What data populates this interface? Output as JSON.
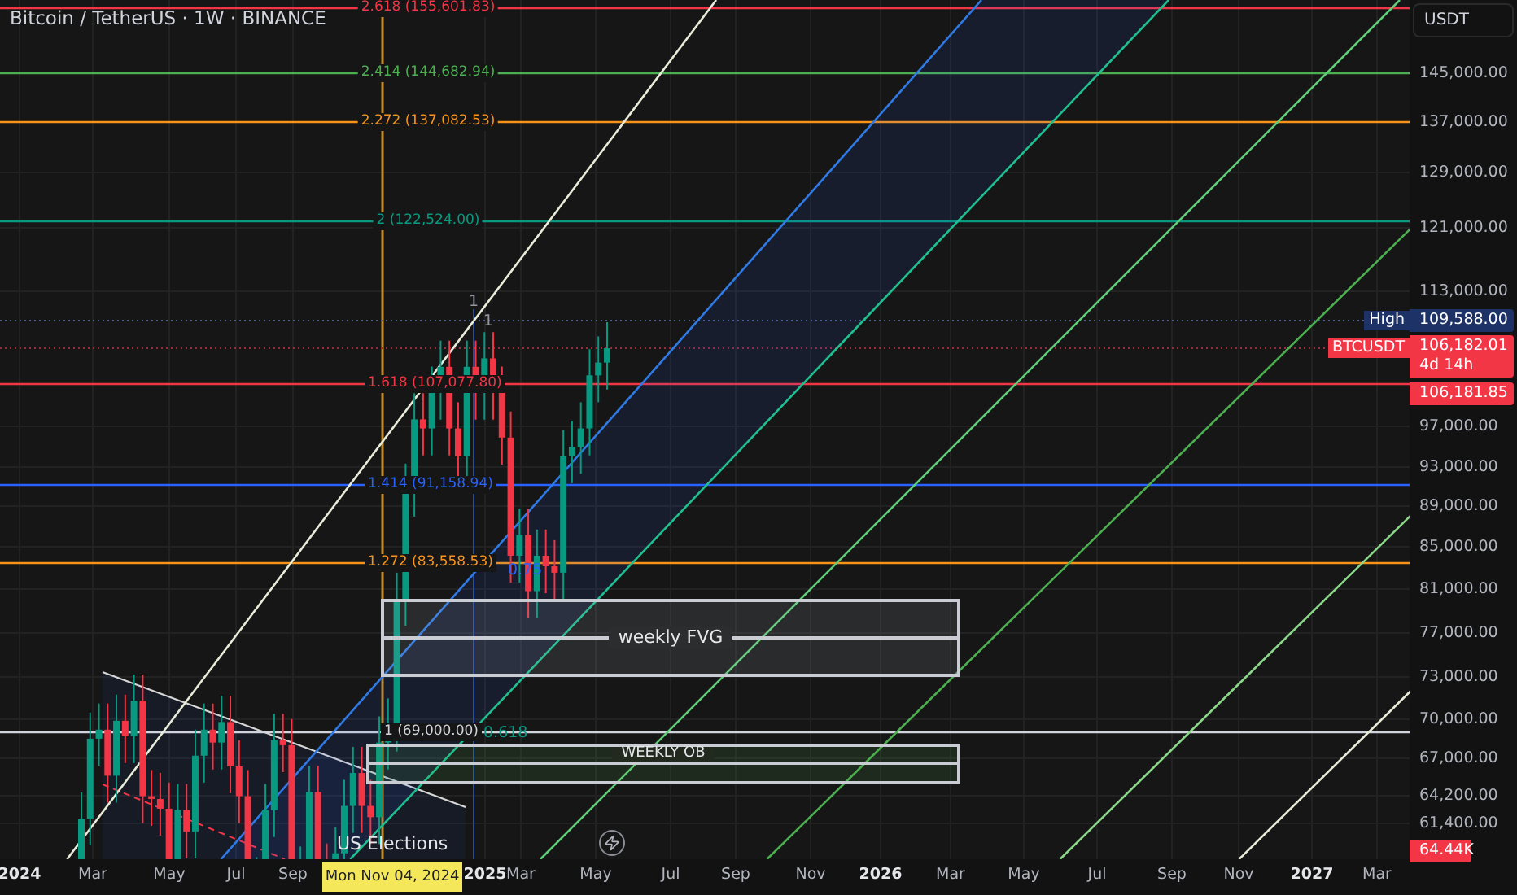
{
  "header": {
    "title": "Bitcoin / TetherUS · 1W · BINANCE"
  },
  "fib_levels": [
    {
      "label": "2.618 (155,601.83)",
      "color": "#f23645"
    },
    {
      "label": "2.414 (144,682.94)",
      "color": "#4caf50"
    },
    {
      "label": "2.272 (137,082.53)",
      "color": "#f7931a"
    },
    {
      "label": "2 (122,524.00)",
      "color": "#089981"
    },
    {
      "label": "1.618 (107,077.80)",
      "color": "#f23645"
    },
    {
      "label": "1.414 (91,158.94)",
      "color": "#2962ff"
    },
    {
      "label": "1.272 (83,558.53)",
      "color": "#f7931a"
    },
    {
      "label": "1 (69,000.00)",
      "color": "#d1d4dc"
    }
  ],
  "channel_labels": [
    {
      "text": "1",
      "color": "#9598a1"
    },
    {
      "text": "1",
      "color": "#9598a1"
    },
    {
      "text": "0.75",
      "color": "#2962ff"
    },
    {
      "text": "0.618",
      "color": "#089981"
    }
  ],
  "zones": [
    {
      "kind": "fvg",
      "label": "weekly FVG"
    },
    {
      "kind": "ob",
      "label": "WEEKLY OB"
    }
  ],
  "event_label": "US Elections",
  "price_axis": {
    "currency": "USDT",
    "ticks": [
      "145,000.00",
      "137,000.00",
      "129,000.00",
      "121,000.00",
      "113,000.00",
      "97,000.00",
      "93,000.00",
      "89,000.00",
      "85,000.00",
      "81,000.00",
      "77,000.00",
      "73,000.00",
      "70,000.00",
      "67,000.00",
      "64,200.00",
      "61,400.00"
    ],
    "high": {
      "tag": "High",
      "value": "109,588.00"
    },
    "last": {
      "tag": "BTCUSDT",
      "value": "106,182.01",
      "countdown": "4d 14h"
    },
    "previous_close": "106,181.85",
    "crosshair": "64.44K"
  },
  "time_axis": {
    "ticks": [
      {
        "label": "2024",
        "major": true
      },
      {
        "label": "Mar",
        "major": false
      },
      {
        "label": "May",
        "major": false
      },
      {
        "label": "Jul",
        "major": false
      },
      {
        "label": "Sep",
        "major": false
      },
      {
        "label": "2025",
        "major": true
      },
      {
        "label": "Mar",
        "major": false
      },
      {
        "label": "May",
        "major": false
      },
      {
        "label": "Jul",
        "major": false
      },
      {
        "label": "Sep",
        "major": false
      },
      {
        "label": "Nov",
        "major": false
      },
      {
        "label": "2026",
        "major": true
      },
      {
        "label": "Mar",
        "major": false
      },
      {
        "label": "May",
        "major": false
      },
      {
        "label": "Jul",
        "major": false
      },
      {
        "label": "Sep",
        "major": false
      },
      {
        "label": "Nov",
        "major": false
      },
      {
        "label": "2027",
        "major": true
      },
      {
        "label": "Mar",
        "major": false
      }
    ],
    "crosshair": "Mon Nov 04, 2024"
  }
}
